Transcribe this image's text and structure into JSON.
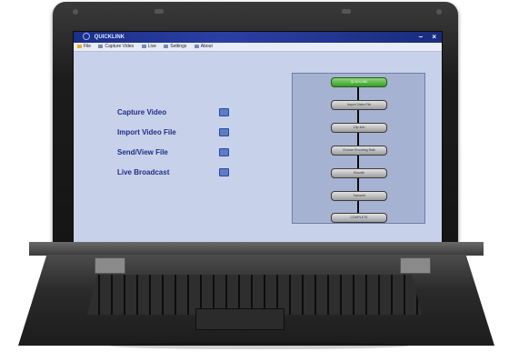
{
  "window": {
    "title": "QUICKLINK"
  },
  "window_controls": {
    "minimize": "–",
    "close": "×"
  },
  "menu": [
    "File",
    "Capture Video",
    "Live",
    "Settings",
    "About"
  ],
  "actions": [
    "Capture Video",
    "Import Video File",
    "Send/View File",
    "Live Broadcast"
  ],
  "steps": [
    "QUICKLINK",
    "Import Video File",
    "Clip Info",
    "Choose Encoding Rate",
    "Encode",
    "Transmit",
    "COMPLETE"
  ],
  "colors": {
    "active_step": "#4caf3a",
    "title_bar": "#1f3390",
    "action_text": "#1f2e86"
  }
}
